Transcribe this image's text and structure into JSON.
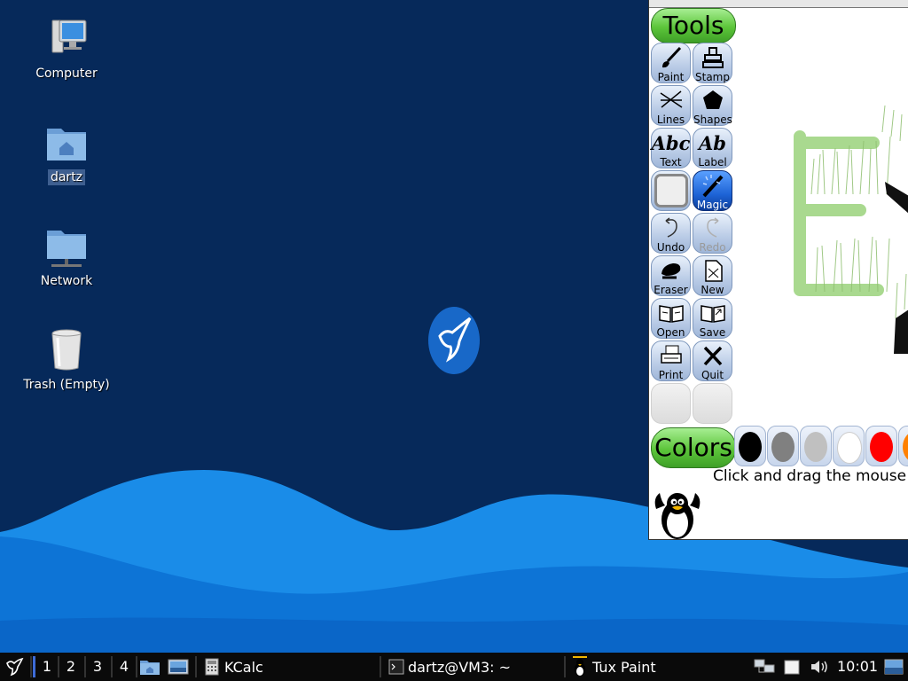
{
  "desktop": {
    "icons": [
      {
        "label": "Computer"
      },
      {
        "label": "dartz"
      },
      {
        "label": "Network"
      },
      {
        "label": "Trash (Empty)"
      }
    ]
  },
  "tuxpaint": {
    "tools_title": "Tools",
    "tools": [
      {
        "label": "Paint",
        "icon": "paintbrush-icon"
      },
      {
        "label": "Stamp",
        "icon": "stamp-icon"
      },
      {
        "label": "Lines",
        "icon": "lines-icon"
      },
      {
        "label": "Shapes",
        "icon": "pentagon-icon"
      },
      {
        "label": "Text",
        "icon": "text-abc-icon",
        "glyph": "Abc"
      },
      {
        "label": "Label",
        "icon": "label-abc-icon",
        "glyph": "Ab"
      },
      {
        "label": "",
        "icon": "blank-icon"
      },
      {
        "label": "Magic",
        "icon": "magic-wand-icon",
        "active": true
      },
      {
        "label": "Undo",
        "icon": "undo-icon"
      },
      {
        "label": "Redo",
        "icon": "redo-icon",
        "disabled": true
      },
      {
        "label": "Eraser",
        "icon": "eraser-icon"
      },
      {
        "label": "New",
        "icon": "new-page-icon"
      },
      {
        "label": "Open",
        "icon": "open-book-icon"
      },
      {
        "label": "Save",
        "icon": "save-book-icon"
      },
      {
        "label": "Print",
        "icon": "printer-icon"
      },
      {
        "label": "Quit",
        "icon": "quit-x-icon"
      }
    ],
    "colors_title": "Colors",
    "colors": [
      "#000000",
      "#808080",
      "#c0c0c0",
      "#ffffff",
      "#ff0000",
      "#ff8000"
    ],
    "status_text": "Click and drag the mouse"
  },
  "taskbar": {
    "workspaces": [
      "1",
      "2",
      "3",
      "4"
    ],
    "tasks": [
      {
        "label": "KCalc",
        "icon": "calculator-icon"
      },
      {
        "label": "dartz@VM3: ~",
        "icon": "terminal-icon"
      },
      {
        "label": "Tux Paint",
        "icon": "tuxpaint-icon"
      }
    ],
    "clock": "10:01"
  }
}
